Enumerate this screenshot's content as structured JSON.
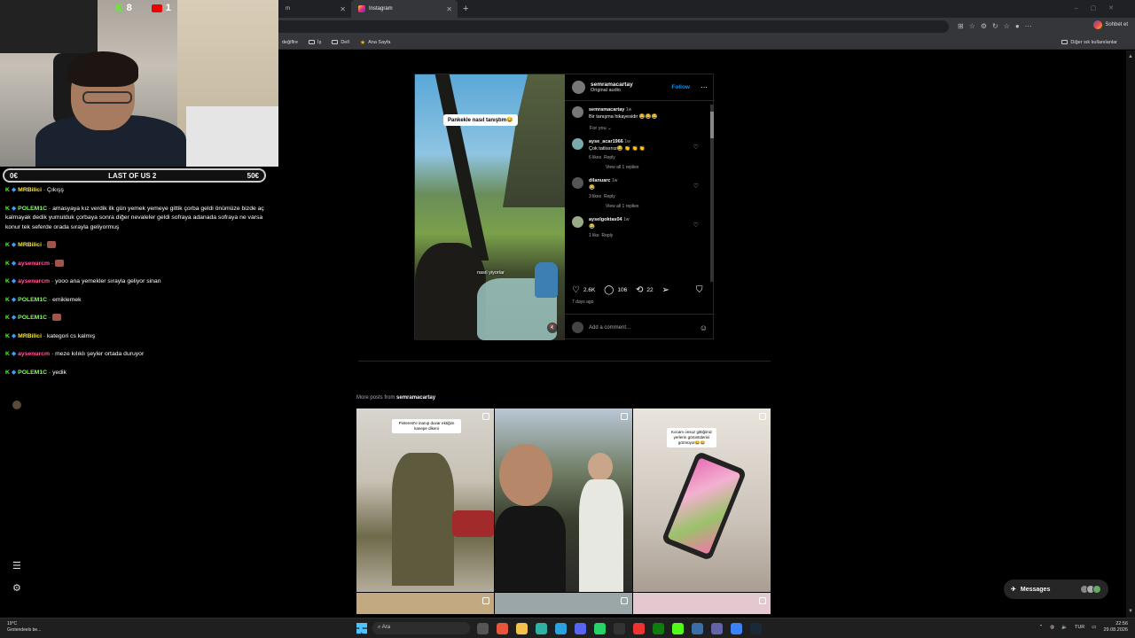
{
  "browser": {
    "tabs": [
      {
        "label": "m"
      },
      {
        "label": "Instagram"
      }
    ],
    "chat_button": "Sohbet et",
    "bookmarks": [
      "değiflre",
      "İş",
      "Dell",
      "Ana Sayfa"
    ],
    "other_bookmarks": "Diğer sık kullanılanlar"
  },
  "post": {
    "author": "semramacartay",
    "audio": "Original audio",
    "follow": "Follow",
    "caption_top": "Pankekle nasıl tanıştım😂",
    "caption_bottom": "nasıl yiyorlar",
    "author_comment": {
      "user": "semramacartay",
      "time": "1w",
      "text": "Bir tanışma hikayesidir 😂😂😂"
    },
    "for_you": "For you",
    "comments": [
      {
        "user": "ayse_acar1966",
        "time": "1w",
        "text": "Çok tatlısınız😂 👏 👏 👏",
        "likes": "6 likes",
        "reply": "Reply",
        "replies": "View all 1 replies"
      },
      {
        "user": "dilanuarc",
        "time": "1w",
        "text": "😂",
        "likes": "3 likes",
        "reply": "Reply",
        "replies": "View all 1 replies"
      },
      {
        "user": "ayselgoktas04",
        "time": "1w",
        "text": "😂",
        "likes": "1 like",
        "reply": "Reply"
      }
    ],
    "likes": "2.6K",
    "comments_count": "106",
    "reposts": "22",
    "ago": "7 days ago",
    "add_comment": "Add a comment..."
  },
  "more_posts": {
    "prefix": "More posts from",
    "user": "semramacartay",
    "captions": [
      "Pinterest'e inanıp duvar ektiğim kanepe dikeni",
      "Kocam onsuz gittiğimiz yerlerin görüntülerini görmüyor😂😂"
    ]
  },
  "messages": {
    "label": "Messages"
  },
  "stream": {
    "kick_count": "8",
    "youtube_count": "1",
    "bet_left": "0€",
    "bet_title": "LAST OF US 2",
    "bet_right": "50€",
    "chat": [
      {
        "user": "MRBilici",
        "color": "#f2e34b",
        "text": "Çıkışş"
      },
      {
        "user": "POLEM1C",
        "color": "#7cff5a",
        "text": "amasyaya kız verdik ilk gün yemek yemeye gittik çorba geldi önümüze bizde aç kalmayak dedik yumulduk çorbaya sonra diğer nevaleler geldi sofraya adanada sofraya ne varsa konur tek seferde orada sırayla geliyormuş"
      },
      {
        "user": "MRBilici",
        "color": "#f2e34b",
        "text": ""
      },
      {
        "user": "aysenurcm",
        "color": "#ff5ca0",
        "text": ""
      },
      {
        "user": "aysenurcm",
        "color": "#ff5ca0",
        "text": "yooo ana yemekler sırayla geliyor sinan"
      },
      {
        "user": "POLEM1C",
        "color": "#7cff5a",
        "text": "emiklemek"
      },
      {
        "user": "POLEM1C",
        "color": "#7cff5a",
        "text": ""
      },
      {
        "user": "MRBilici",
        "color": "#f2e34b",
        "text": "kategori cs kalmış"
      },
      {
        "user": "aysenurcm",
        "color": "#ff5ca0",
        "text": "meze kılıklı şeyler ortada duruyor"
      },
      {
        "user": "POLEM1C",
        "color": "#7cff5a",
        "text": "yedik"
      }
    ]
  },
  "taskbar": {
    "weather_temp": "19°C",
    "weather_desc": "Grotendeels be...",
    "search": "Ara",
    "lang": "TUR",
    "time": "22:56",
    "date": "29.08.2026"
  }
}
